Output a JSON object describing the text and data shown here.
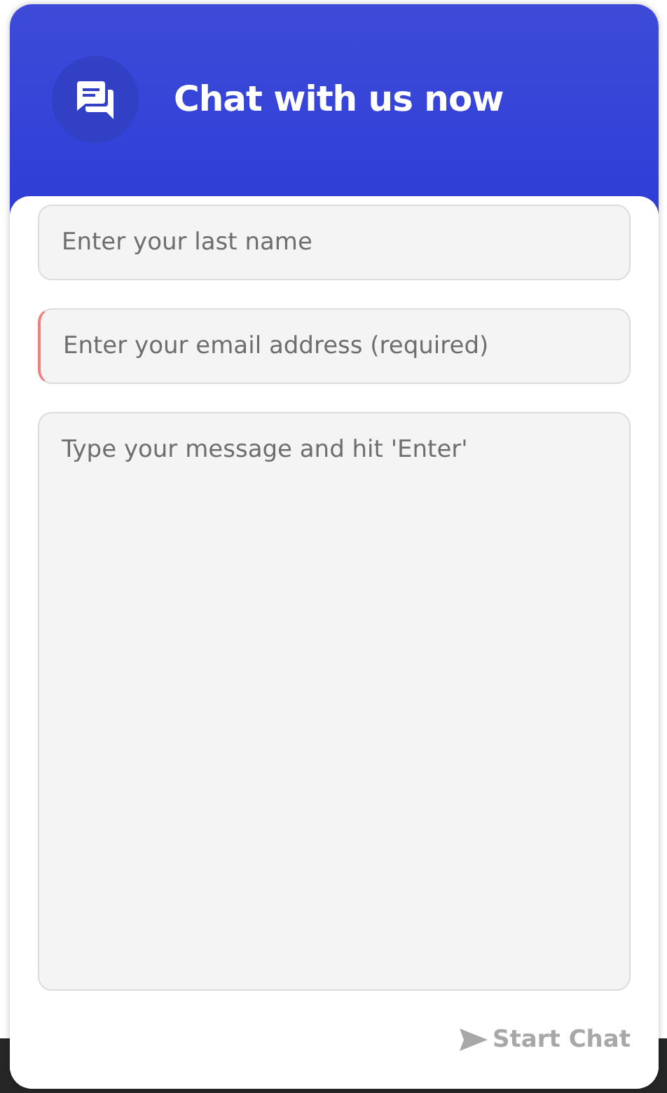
{
  "header": {
    "title": "Chat with us now"
  },
  "fields": [
    {
      "kind": "input",
      "placeholder": "Enter your last name",
      "invalid": false
    },
    {
      "kind": "input",
      "placeholder": "Enter your email address (required)",
      "invalid": true
    },
    {
      "kind": "textarea",
      "placeholder": "Type your message and hit 'Enter'",
      "invalid": false
    }
  ],
  "submit": {
    "label": "Start Chat",
    "disabled": true
  }
}
